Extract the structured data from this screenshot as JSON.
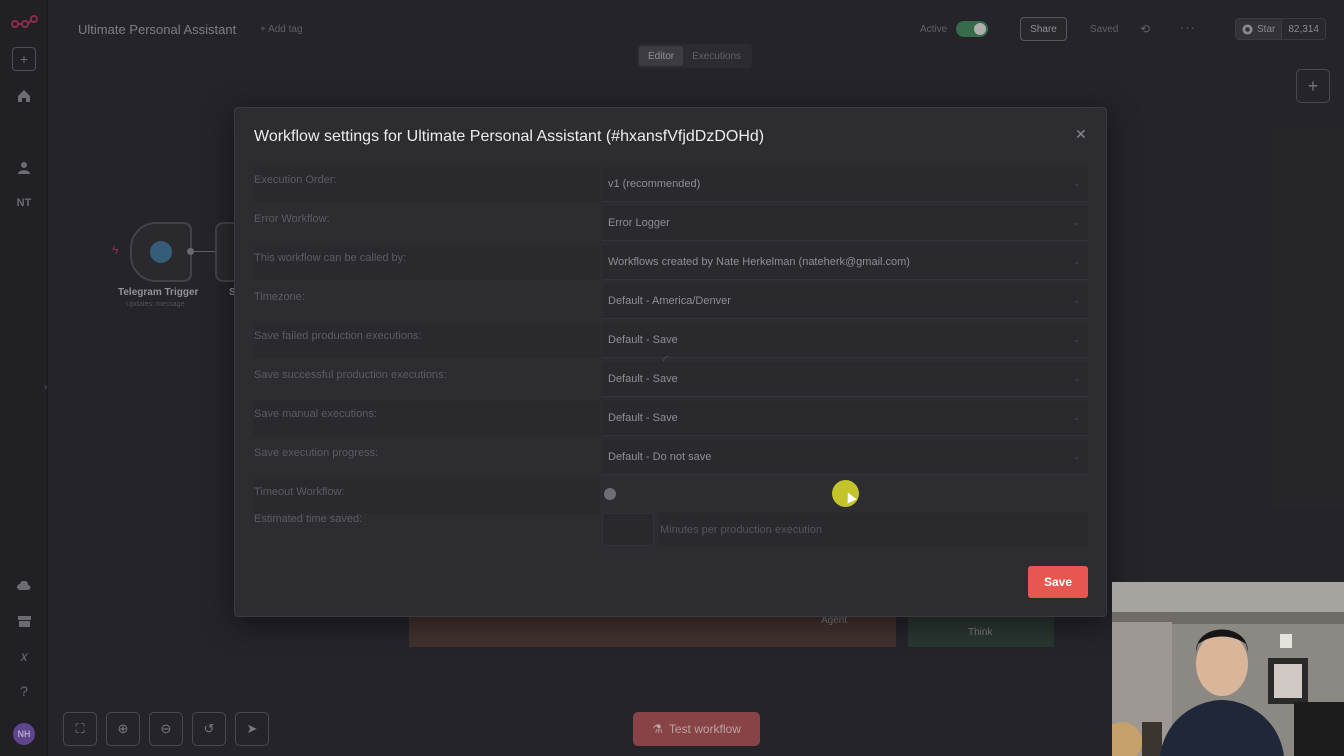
{
  "app": {
    "workflow_name": "Ultimate Personal Assistant",
    "add_tag": "+ Add tag"
  },
  "header": {
    "active_label": "Active",
    "share_label": "Share",
    "saved_label": "Saved",
    "github": {
      "star_label": "Star",
      "star_count": "82,314"
    },
    "tabs": [
      {
        "label": "Editor"
      },
      {
        "label": "Executions"
      }
    ]
  },
  "rail": {
    "initials": "NT",
    "avatar": "NH"
  },
  "canvas": {
    "trigger_node": {
      "title": "Telegram Trigger",
      "subtitle": "Updates: message"
    },
    "second_node_label": "S",
    "agent_label": "Agent",
    "think_label": "Think"
  },
  "modal": {
    "title": "Workflow settings for Ultimate Personal Assistant (#hxansfVfjdDzDOHd)",
    "rows": [
      {
        "label": "Execution Order:",
        "value": "v1 (recommended)"
      },
      {
        "label": "Error Workflow:",
        "value": "Error Logger"
      },
      {
        "label": "This workflow can be called by:",
        "value": "Workflows created by Nate Herkelman (nateherk@gmail.com)"
      },
      {
        "label": "Timezone:",
        "value": "Default - America/Denver"
      },
      {
        "label": "Save failed production executions:",
        "value": "Default - Save"
      },
      {
        "label": "Save successful production executions:",
        "value": "Default - Save"
      },
      {
        "label": "Save manual executions:",
        "value": "Default - Save"
      },
      {
        "label": "Save execution progress:",
        "value": "Default - Do not save"
      }
    ],
    "timeout_label": "Timeout Workflow:",
    "time_saved_label": "Estimated time saved:",
    "time_saved_unit": "Minutes per production execution",
    "save_label": "Save"
  },
  "footer": {
    "test_workflow_label": "Test workflow"
  },
  "colors": {
    "accent": "#e8574f",
    "active_toggle": "#3f7a55",
    "cursor_highlight": "#c4c32a"
  }
}
